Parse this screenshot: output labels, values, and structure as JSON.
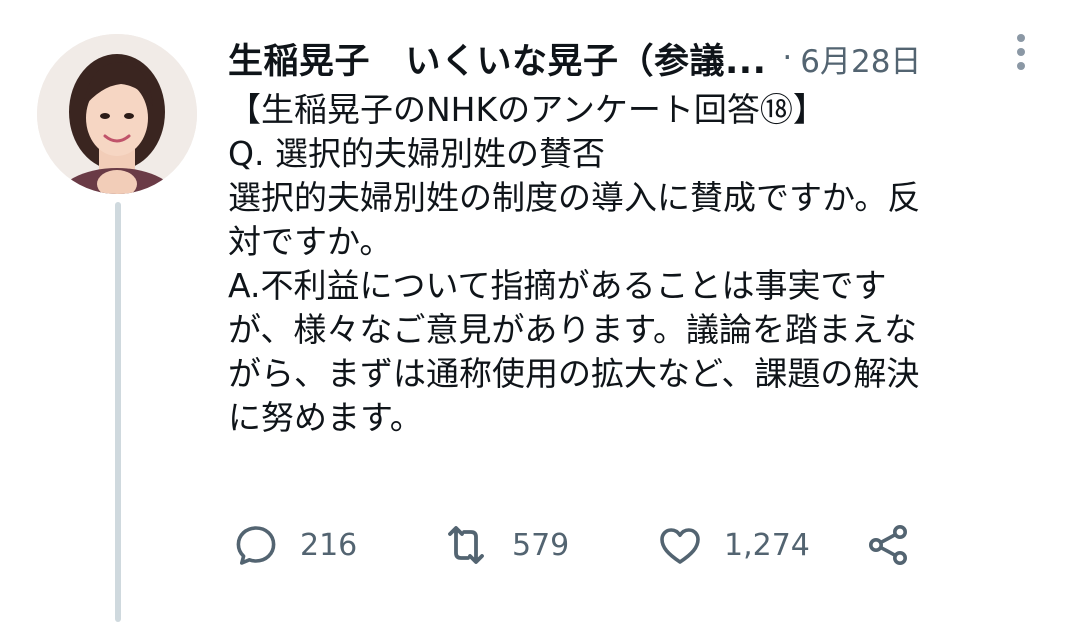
{
  "tweet": {
    "display_name": "生稲晃子　いくいな晃子（参議...",
    "separator": "·",
    "date": "6月28日",
    "lines": [
      "【生稲晃子のNHKのアンケート回答⑱】",
      "Q. 選択的夫婦別姓の賛否",
      "選択的夫婦別姓の制度の導入に賛成ですか。反",
      "対ですか。",
      "A.不利益について指摘があることは事実です",
      "が、様々なご意見があります。議論を踏まえな",
      "がら、まずは通称使用の拡大など、課題の解決",
      "に努めます。"
    ],
    "metrics": {
      "replies": "216",
      "retweets": "579",
      "likes": "1,274"
    }
  },
  "icons": {
    "reply": "reply-icon",
    "retweet": "retweet-icon",
    "like": "heart-icon",
    "share": "share-icon",
    "more": "more-vertical-icon"
  },
  "colors": {
    "text": "#0f1419",
    "secondary": "#536471",
    "thread_line": "#cfd9de"
  }
}
